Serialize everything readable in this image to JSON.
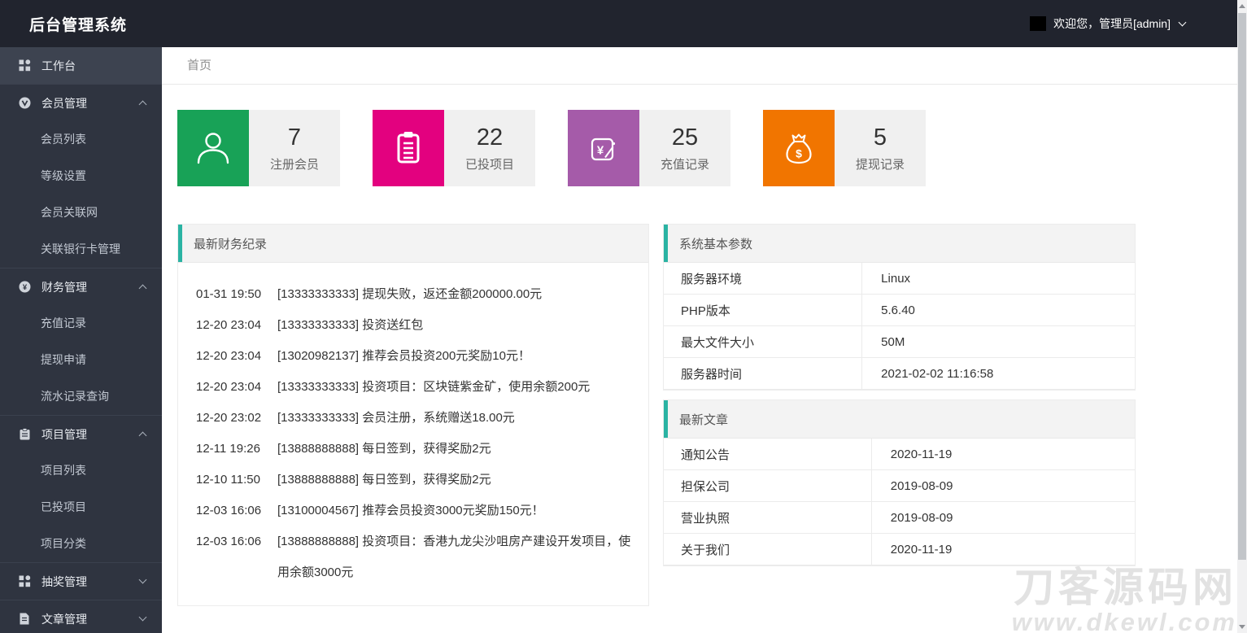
{
  "header": {
    "title": "后台管理系统",
    "welcome": "欢迎您，管理员[admin]"
  },
  "breadcrumb": {
    "home": "首页"
  },
  "sidebar": {
    "items": [
      {
        "label": "工作台",
        "icon": "grid-icon",
        "active": true,
        "children": []
      },
      {
        "label": "会员管理",
        "icon": "user-circle-icon",
        "expanded": true,
        "children": [
          {
            "label": "会员列表"
          },
          {
            "label": "等级设置"
          },
          {
            "label": "会员关联网"
          },
          {
            "label": "关联银行卡管理"
          }
        ]
      },
      {
        "label": "财务管理",
        "icon": "yen-circle-icon",
        "expanded": true,
        "children": [
          {
            "label": "充值记录"
          },
          {
            "label": "提现申请"
          },
          {
            "label": "流水记录查询"
          }
        ]
      },
      {
        "label": "项目管理",
        "icon": "clipboard-icon",
        "expanded": true,
        "children": [
          {
            "label": "项目列表"
          },
          {
            "label": "已投项目"
          },
          {
            "label": "项目分类"
          }
        ]
      },
      {
        "label": "抽奖管理",
        "icon": "grid-icon",
        "expanded": false,
        "children": []
      },
      {
        "label": "文章管理",
        "icon": "document-icon",
        "expanded": false,
        "children": []
      }
    ]
  },
  "stats": [
    {
      "value": "7",
      "label": "注册会员",
      "color": "#18a257",
      "icon": "user-icon"
    },
    {
      "value": "22",
      "label": "已投项目",
      "color": "#e3017f",
      "icon": "clipboard-icon"
    },
    {
      "value": "25",
      "label": "充值记录",
      "color": "#a55ba9",
      "icon": "yen-card-icon"
    },
    {
      "value": "5",
      "label": "提现记录",
      "color": "#f17500",
      "icon": "money-bag-icon"
    }
  ],
  "finance_panel": {
    "title": "最新财务纪录",
    "accent_color": "#2ab3a3",
    "records": [
      {
        "time": "01-31 19:50",
        "text": "[13333333333] 提现失败，返还金额200000.00元"
      },
      {
        "time": "12-20 23:04",
        "text": "[13333333333] 投资送红包"
      },
      {
        "time": "12-20 23:04",
        "text": "[13020982137] 推荐会员投资200元奖励10元！"
      },
      {
        "time": "12-20 23:04",
        "text": "[13333333333] 投资项目：区块链紫金矿，使用余额200元"
      },
      {
        "time": "12-20 23:02",
        "text": "[13333333333] 会员注册，系统赠送18.00元"
      },
      {
        "time": "12-11 19:26",
        "text": "[13888888888] 每日签到，获得奖励2元"
      },
      {
        "time": "12-10 11:50",
        "text": "[13888888888] 每日签到，获得奖励2元"
      },
      {
        "time": "12-03 16:06",
        "text": "[13100004567] 推荐会员投资3000元奖励150元！"
      },
      {
        "time": "12-03 16:06",
        "text": "[13888888888] 投资项目：香港九龙尖沙咀房产建设开发项目，使用余额3000元"
      }
    ]
  },
  "system_panel": {
    "title": "系统基本参数",
    "accent_color": "#2ab3a3",
    "rows": [
      {
        "label": "服务器环境",
        "value": "Linux"
      },
      {
        "label": "PHP版本",
        "value": "5.6.40"
      },
      {
        "label": "最大文件大小",
        "value": "50M"
      },
      {
        "label": "服务器时间",
        "value": "2021-02-02 11:16:58"
      }
    ]
  },
  "articles_panel": {
    "title": "最新文章",
    "accent_color": "#2ab3a3",
    "rows": [
      {
        "label": "通知公告",
        "value": "2020-11-19"
      },
      {
        "label": "担保公司",
        "value": "2019-08-09"
      },
      {
        "label": "营业执照",
        "value": "2019-08-09"
      },
      {
        "label": "关于我们",
        "value": "2020-11-19"
      }
    ]
  },
  "watermark": {
    "line1": "刀客源码网",
    "line2": "www.dkewl.com"
  }
}
